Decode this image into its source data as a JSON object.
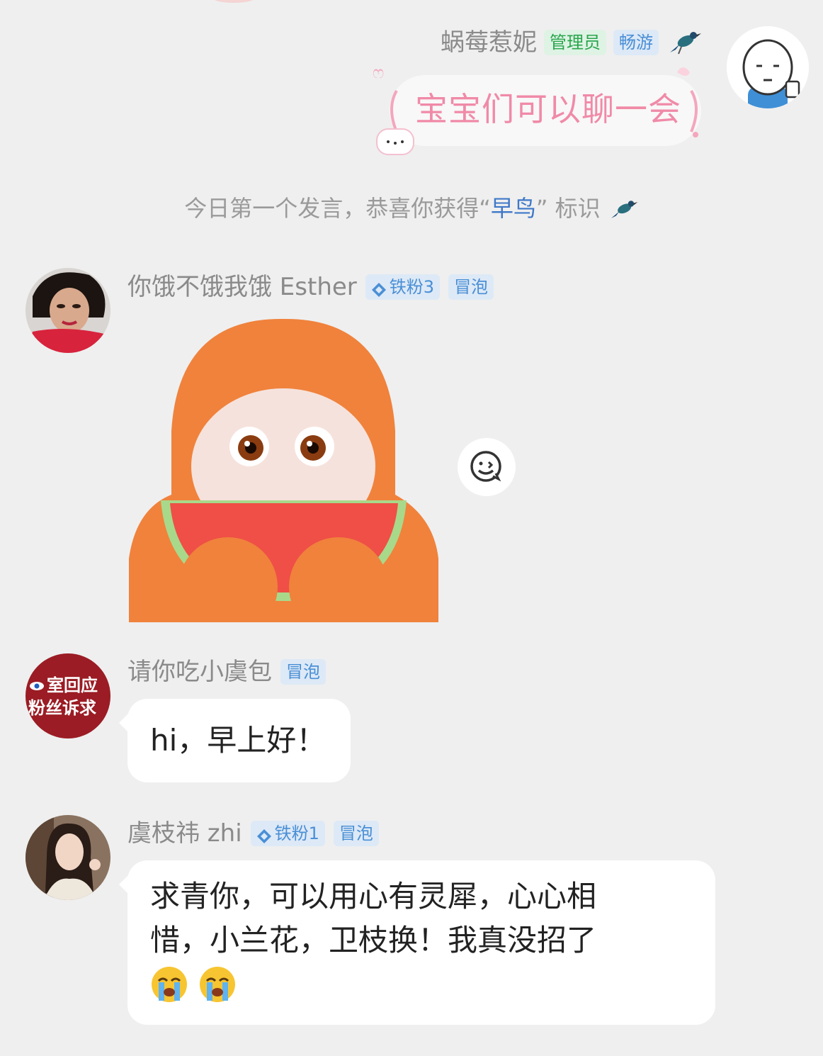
{
  "messages": [
    {
      "username": "蜗莓惹妮",
      "tags": [
        "管理员",
        "畅游"
      ],
      "text": "宝宝们可以聊一会"
    },
    {
      "system_notice": {
        "prefix": "今日第一个发言，恭喜你获得",
        "quote_open": "“",
        "highlight": "早鸟",
        "quote_close": "”",
        "suffix": "标识"
      }
    },
    {
      "username": "你饿不饿我饿 Esther",
      "fan_badge": "铁粉3",
      "tags": [
        "冒泡"
      ],
      "sticker": "orange-monster-eating-watermelon"
    },
    {
      "username": "请你吃小虞包",
      "avatar_text": [
        "室回应",
        "粉丝诉求"
      ],
      "tags": [
        "冒泡"
      ],
      "text": "hi，早上好！"
    },
    {
      "username": "虞枝祎 zhi",
      "fan_badge": "铁粉1",
      "tags": [
        "冒泡"
      ],
      "text_line1": "求青你，可以用心有灵犀，心心相",
      "text_line2": "惜，小兰花，卫枝换！我真没招了",
      "emojis": [
        "😭",
        "😭"
      ]
    }
  ],
  "colors": {
    "background": "#efefef",
    "admin_tag": "#2aa64c",
    "blue_tag": "#4a8fd6",
    "pink_bubble_text": "#f08aa8",
    "highlight": "#3f78c8"
  }
}
